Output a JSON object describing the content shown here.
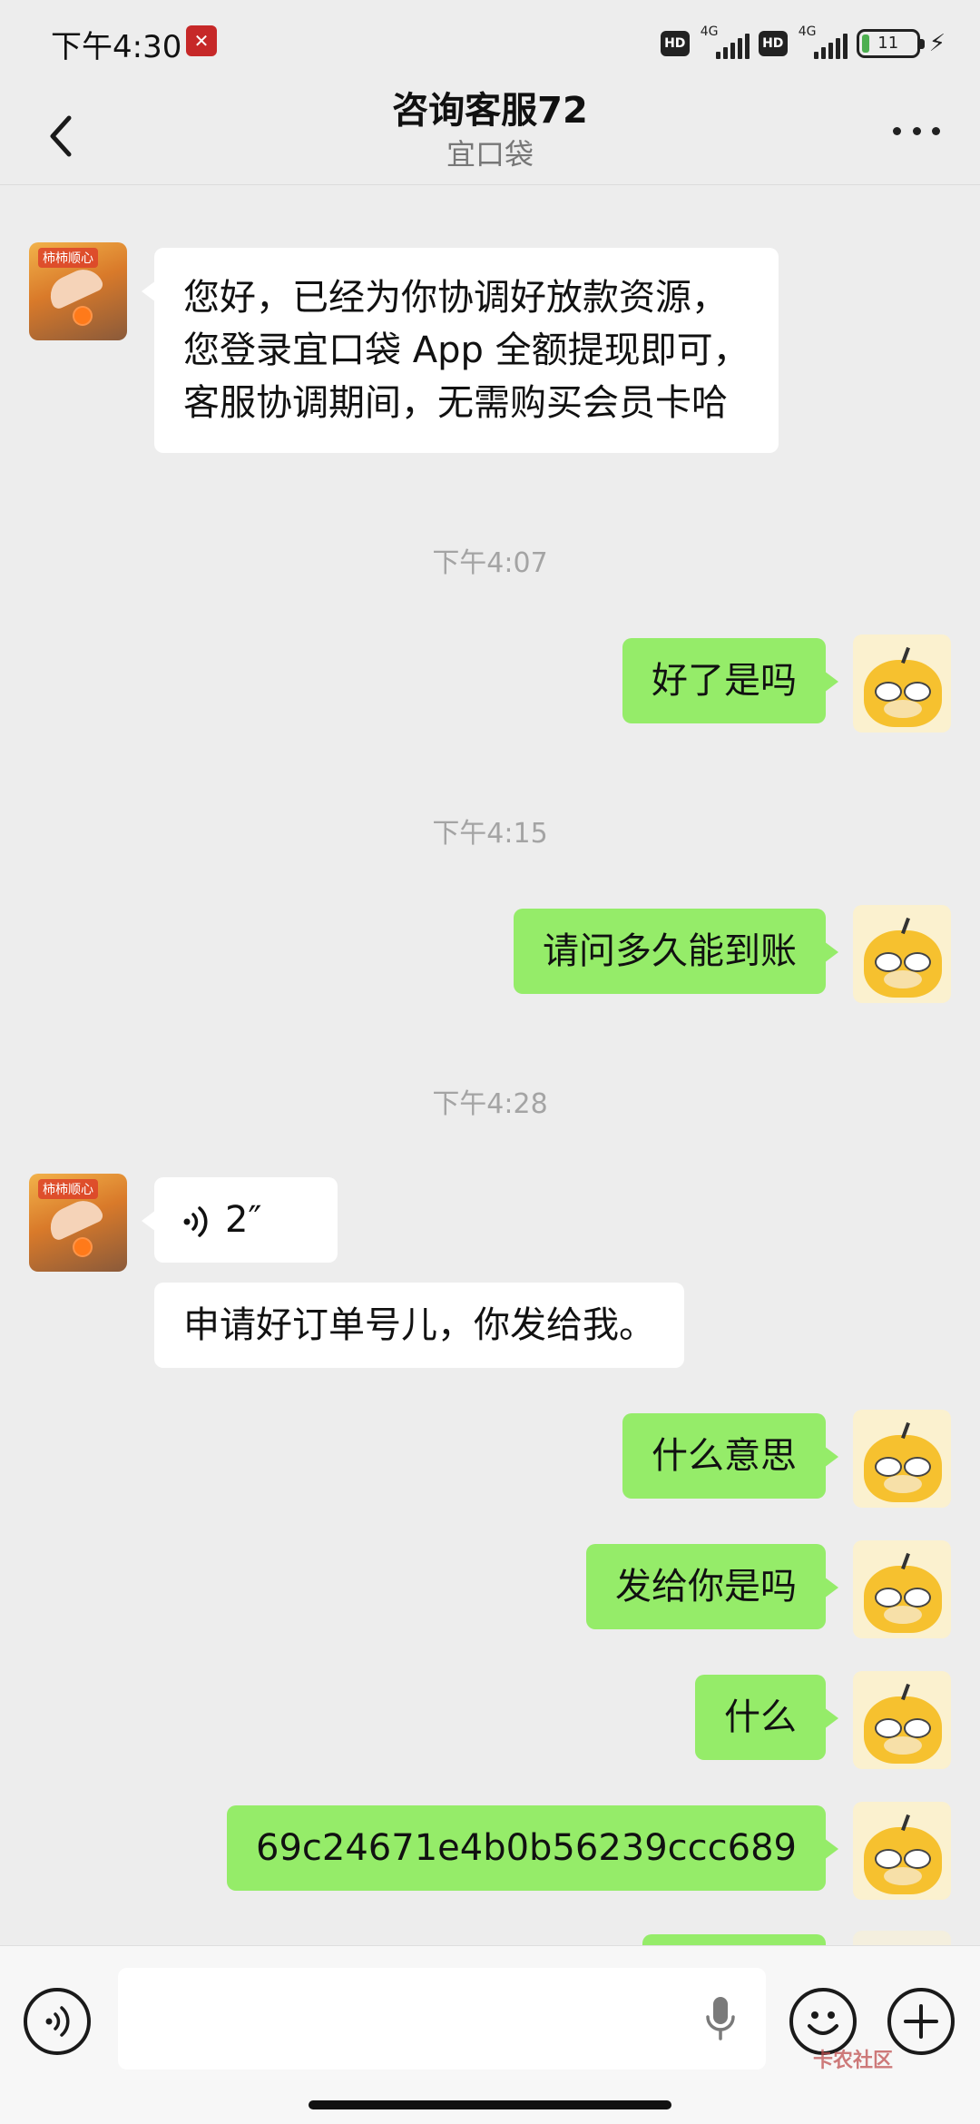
{
  "status_bar": {
    "time": "下午4:30",
    "network_1": "4G",
    "network_2": "4G",
    "hd_label": "HD",
    "battery_level": "11"
  },
  "header": {
    "title": "咨询客服72",
    "subtitle": "宜口袋"
  },
  "messages": {
    "m1_line1": "您好，已经为你协调好放款资源，",
    "m1_line2": "您登录宜口袋 App 全额提现即可，",
    "m1_line3": "客服协调期间，无需购买会员卡哈",
    "ts1": "下午4:07",
    "m2": "好了是吗",
    "ts2": "下午4:15",
    "m3": "请问多久能到账",
    "ts3": "下午4:28",
    "voice_duration": "2″",
    "m4": "申请好订单号儿，你发给我。",
    "m5": "什么意思",
    "m6": "发给你是吗",
    "m7": "什么",
    "m8": "69c24671e4b0b56239ccc689"
  },
  "watermark": "卡农社区",
  "colors": {
    "background": "#ededed",
    "self_bubble": "#95ec69",
    "other_bubble": "#ffffff",
    "timestamp": "#a4a4a4"
  },
  "icons": [
    "back-arrow-icon",
    "more-icon",
    "voice-icon",
    "mic-icon",
    "emoji-icon",
    "plus-icon"
  ]
}
